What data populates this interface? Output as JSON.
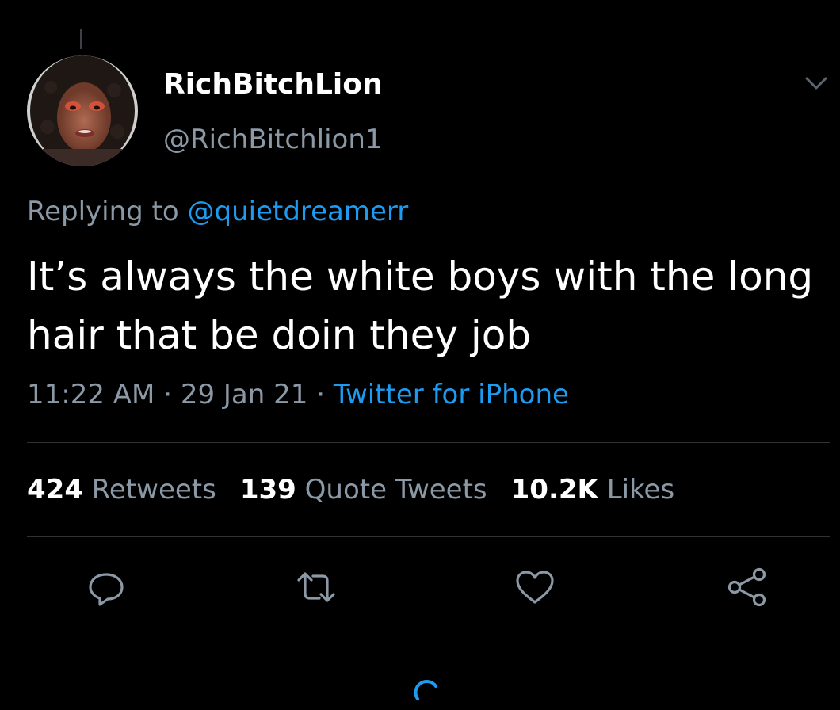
{
  "tweet": {
    "display_name": "RichBitchLion",
    "handle": "@RichBitchlion1",
    "replying_prefix": "Replying to",
    "replying_to": "@quietdreamerr",
    "text": "It’s always the white boys with the long hair that be doin they job",
    "time": "11:22 AM",
    "date": "29 Jan 21",
    "dot": "·",
    "source": "Twitter for iPhone"
  },
  "stats": {
    "retweets_count": "424",
    "retweets_label": "Retweets",
    "quotes_count": "139",
    "quotes_label": "Quote Tweets",
    "likes_count": "10.2K",
    "likes_label": "Likes"
  },
  "icons": {
    "avatar": "profile-photo",
    "more": "chevron-down-icon",
    "reply": "reply-icon",
    "retweet": "retweet-icon",
    "like": "heart-icon",
    "share": "share-icon",
    "loading": "spinner-icon"
  },
  "colors": {
    "background": "#000000",
    "text_primary": "#ffffff",
    "text_secondary": "#8b98a5",
    "accent": "#1d9bf0",
    "divider": "#2f3336"
  }
}
